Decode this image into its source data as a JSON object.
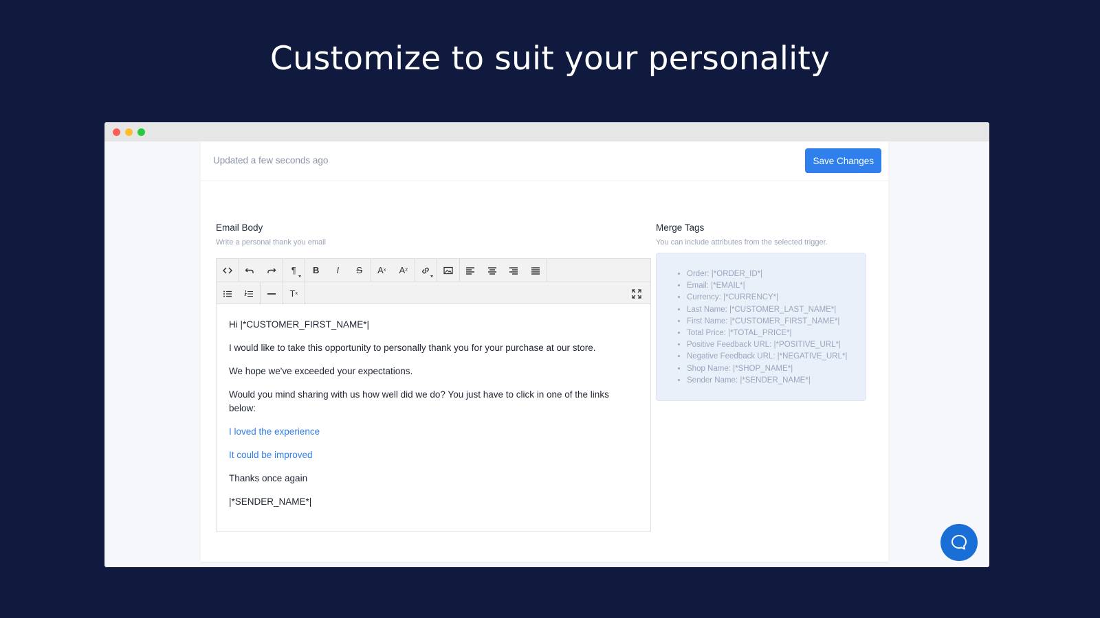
{
  "headline": "Customize to suit your personality",
  "header": {
    "updated": "Updated a few seconds ago",
    "save_label": "Save Changes"
  },
  "email_body": {
    "title": "Email Body",
    "subtitle": "Write a personal thank you email"
  },
  "merge_tags": {
    "title": "Merge Tags",
    "subtitle": "You can include attributes from the selected trigger.",
    "items": [
      "Order: |*ORDER_ID*|",
      "Email: |*EMAIL*|",
      "Currency: |*CURRENCY*|",
      "Last Name: |*CUSTOMER_LAST_NAME*|",
      "First Name: |*CUSTOMER_FIRST_NAME*|",
      "Total Price: |*TOTAL_PRICE*|",
      "Positive Feedback URL: |*POSITIVE_URL*|",
      "Negative Feedback URL: |*NEGATIVE_URL*|",
      "Shop Name: |*SHOP_NAME*|",
      "Sender Name: |*SENDER_NAME*|"
    ]
  },
  "editor": {
    "toolbar": {
      "paragraph": "¶",
      "bold": "B",
      "italic": "I",
      "strike": "S",
      "superscript": "A",
      "sup_mark": "x",
      "subscript": "A",
      "sub_mark": "2",
      "clear": "T",
      "clear_mark": "x"
    },
    "content": {
      "greeting": "Hi |*CUSTOMER_FIRST_NAME*|",
      "line1": "I would like to take this opportunity to personally thank you for your purchase at our store.",
      "line2": "We hope we've exceeded your expectations.",
      "line3": "Would you mind sharing with us how well did we do? You just have to click in one of the links below:",
      "link_positive": "I loved the experience",
      "link_negative": "It could be improved",
      "thanks": "Thanks once again",
      "signature": "|*SENDER_NAME*|"
    }
  },
  "colors": {
    "background": "#0f1a3e",
    "accent": "#2f80ed",
    "chat": "#1a6fd6"
  }
}
